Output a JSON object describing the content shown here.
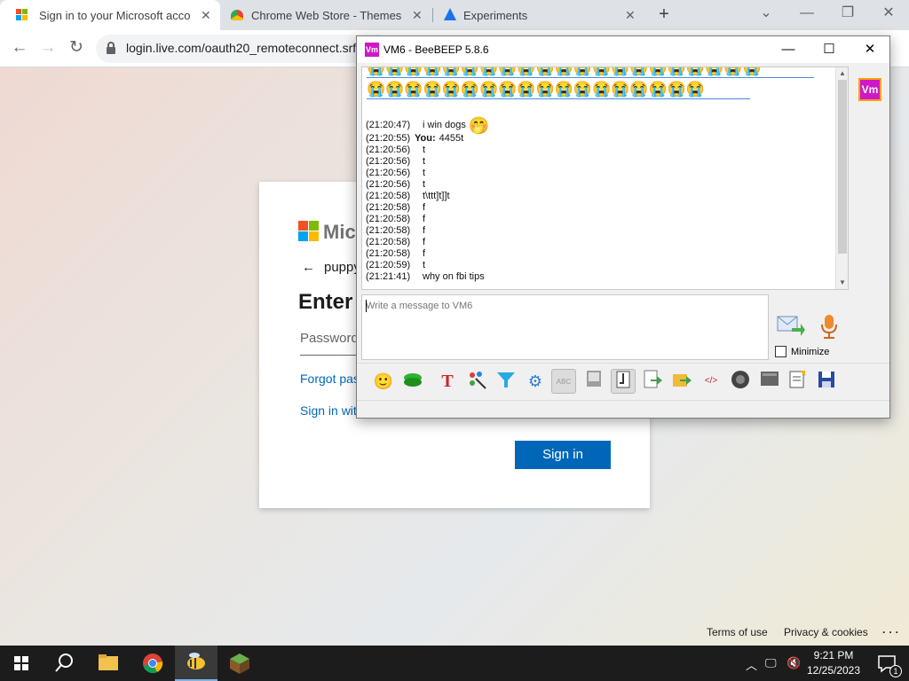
{
  "browser": {
    "tabs": [
      {
        "title": "Sign in to your Microsoft accou",
        "icon": "windows-logo-icon",
        "active": true
      },
      {
        "title": "Chrome Web Store - Themes",
        "icon": "chrome-web-store-icon",
        "active": false
      },
      {
        "title": "Experiments",
        "icon": "flask-icon",
        "active": false
      }
    ],
    "close_glyph": "✕",
    "new_tab_glyph": "+",
    "url": "login.live.com/oauth20_remoteconnect.srf"
  },
  "login_page": {
    "brand": "Micr",
    "account": "puppy",
    "title": "Enter",
    "password_placeholder": "Password",
    "forgot_link": "Forgot pass",
    "signin_with_link": "Sign in with",
    "signin_button": "Sign in",
    "footer_terms": "Terms of use",
    "footer_privacy": "Privacy & cookies",
    "footer_more": "· · ·"
  },
  "beebeep": {
    "title": "VM6 - BeeBEEP 5.8.6",
    "avatar_text": "Vm",
    "emoji": "😭",
    "messages": [
      {
        "time": "(21:20:47)",
        "text": "i win dogs",
        "emoji": "🤭"
      },
      {
        "time": "(21:20:55)",
        "sender": "You:",
        "text": "4455t"
      },
      {
        "time": "(21:20:56)",
        "text": "t"
      },
      {
        "time": "(21:20:56)",
        "text": "t"
      },
      {
        "time": "(21:20:56)",
        "text": "t"
      },
      {
        "time": "(21:20:56)",
        "text": "t"
      },
      {
        "time": "(21:20:58)",
        "text": "t\\ttt]t]]t"
      },
      {
        "time": "(21:20:58)",
        "text": "f"
      },
      {
        "time": "(21:20:58)",
        "text": "f"
      },
      {
        "time": "(21:20:58)",
        "text": "f"
      },
      {
        "time": "(21:20:58)",
        "text": "f"
      },
      {
        "time": "(21:20:58)",
        "text": "f"
      },
      {
        "time": "(21:20:59)",
        "text": "t"
      },
      {
        "time": "(21:21:41)",
        "text": "why on fbi tips"
      }
    ],
    "input_placeholder": "Write a message to VM6",
    "minimize_label": "Minimize",
    "toolbar_icons": [
      "emoticon-icon",
      "screen-share-icon",
      "font-icon",
      "color-picker-icon",
      "filter-icon",
      "settings-gear-icon",
      "spellcheck-icon",
      "dictionary-icon",
      "compact-view-icon",
      "send-file-icon",
      "send-folder-icon",
      "code-icon",
      "screenshot-icon",
      "clear-icon",
      "notes-icon",
      "save-chat-icon"
    ]
  },
  "taskbar": {
    "time": "9:21 PM",
    "date": "12/25/2023",
    "notification_count": "1"
  }
}
